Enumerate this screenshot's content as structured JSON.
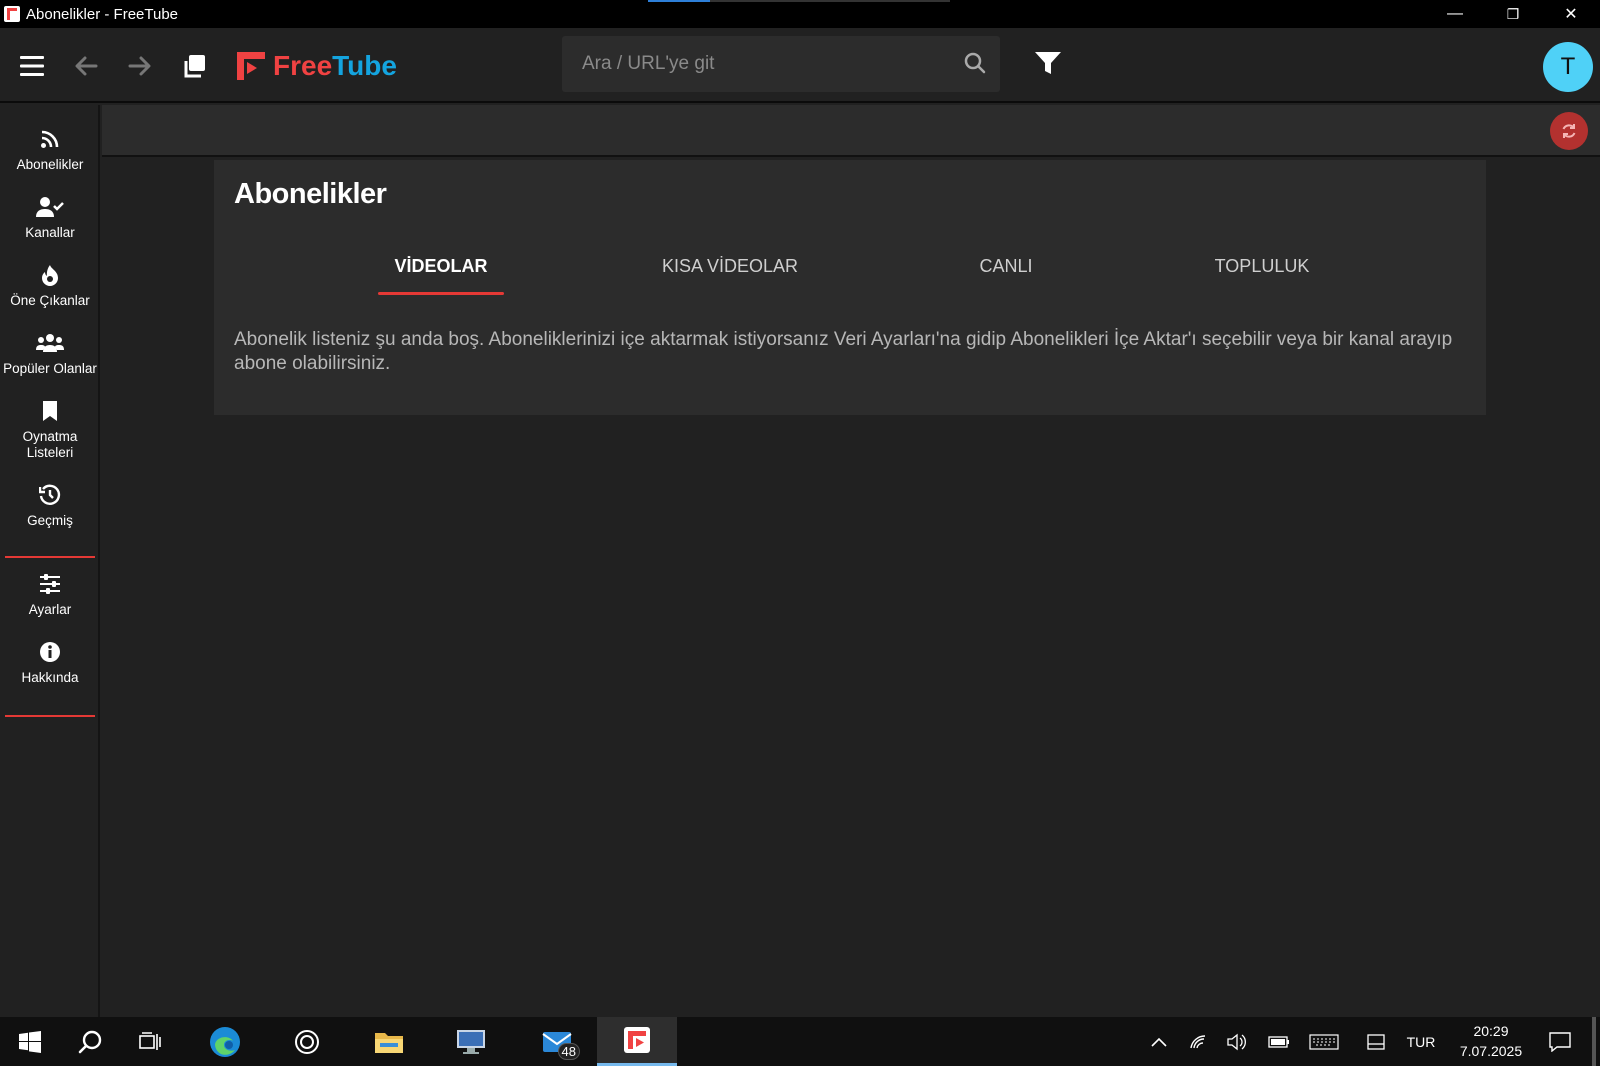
{
  "window": {
    "title": "Abonelikler - FreeTube",
    "minimize": "—",
    "restore": "❐",
    "close": "✕"
  },
  "topnav": {
    "logo_free": "Free",
    "logo_tube": "Tube",
    "search_placeholder": "Ara / URL'ye git",
    "avatar_letter": "T"
  },
  "sidebar": {
    "items": [
      {
        "label": "Abonelikler",
        "icon": "rss-icon"
      },
      {
        "label": "Kanallar",
        "icon": "user-check-icon"
      },
      {
        "label": "Öne Çıkanlar",
        "icon": "fire-icon"
      },
      {
        "label": "Popüler Olanlar",
        "icon": "users-icon"
      },
      {
        "label": "Oynatma Listeleri",
        "icon": "bookmark-icon"
      },
      {
        "label": "Geçmiş",
        "icon": "history-icon"
      },
      {
        "label": "Ayarlar",
        "icon": "sliders-icon"
      },
      {
        "label": "Hakkında",
        "icon": "info-icon"
      }
    ]
  },
  "main": {
    "title": "Abonelikler",
    "tabs": [
      {
        "label": "VİDEOLAR",
        "active": true
      },
      {
        "label": "KISA VİDEOLAR",
        "active": false
      },
      {
        "label": "CANLI",
        "active": false
      },
      {
        "label": "TOPLULUK",
        "active": false
      }
    ],
    "empty_message": "Abonelik listeniz şu anda boş. Aboneliklerinizi içe aktarmak istiyorsanız Veri Ayarları'na gidip Abonelikleri İçe Aktar'ı seçebilir veya bir kanal arayıp abone olabilirsiniz."
  },
  "taskbar": {
    "mail_badge": "48",
    "language": "TUR",
    "time": "20:29",
    "date": "7.07.2025"
  },
  "colors": {
    "accent_red": "#e53935",
    "logo_blue": "#14a4df",
    "avatar_bg": "#4fd1f7",
    "background": "#212121",
    "card": "#2c2c2c"
  }
}
